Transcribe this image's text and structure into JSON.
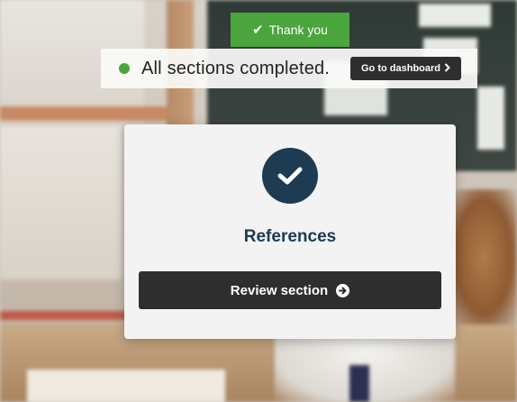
{
  "banner": {
    "label": "Thank you",
    "icon": "check-icon"
  },
  "status": {
    "message": "All sections completed.",
    "dashboard_button": "Go to dashboard",
    "dot_color": "#4aa63c"
  },
  "card": {
    "icon": "check-circle-icon",
    "title": "References",
    "review_button": "Review section",
    "review_icon": "arrow-circle-right-icon",
    "accent": "#1d3b52"
  },
  "colors": {
    "success": "#4aa63c",
    "button_dark": "#2e2e2e"
  }
}
